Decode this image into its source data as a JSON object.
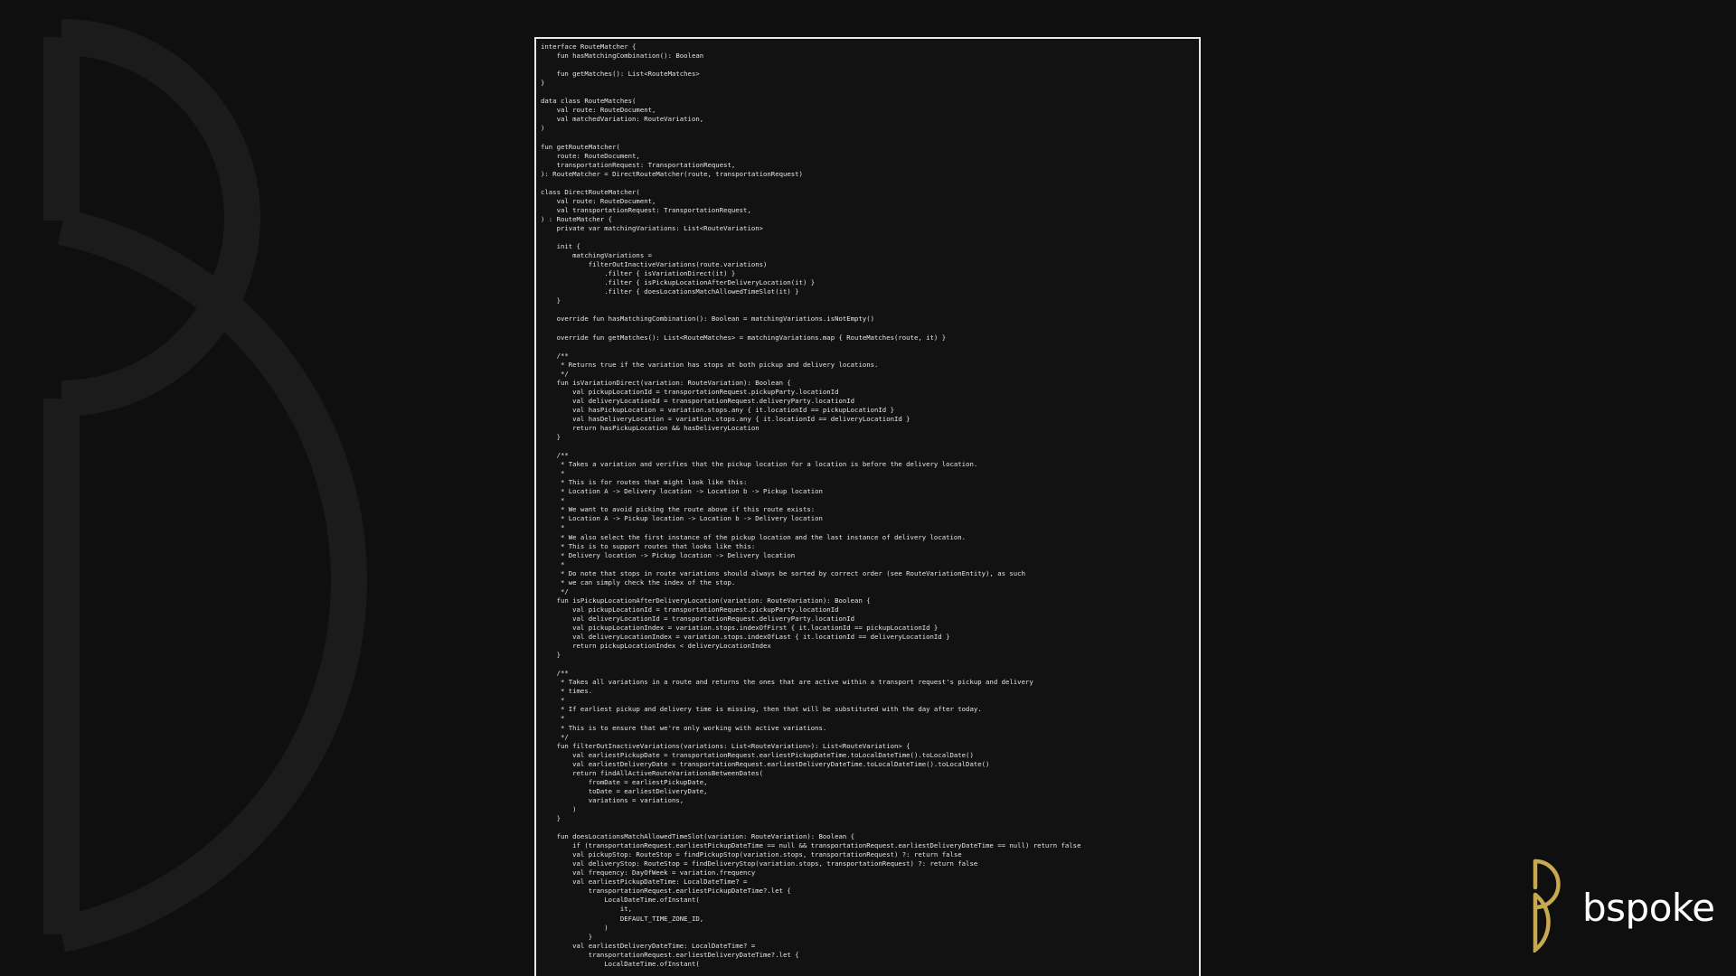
{
  "brand": {
    "name": "bspoke",
    "accent_color": "#c9a94f",
    "background_mark_color": "#1b1b1c"
  },
  "code": {
    "language": "kotlin",
    "lines": [
      "interface RouteMatcher {",
      "    fun hasMatchingCombination(): Boolean",
      "",
      "    fun getMatches(): List<RouteMatches>",
      "}",
      "",
      "data class RouteMatches(",
      "    val route: RouteDocument,",
      "    val matchedVariation: RouteVariation,",
      ")",
      "",
      "fun getRouteMatcher(",
      "    route: RouteDocument,",
      "    transportationRequest: TransportationRequest,",
      "): RouteMatcher = DirectRouteMatcher(route, transportationRequest)",
      "",
      "class DirectRouteMatcher(",
      "    val route: RouteDocument,",
      "    val transportationRequest: TransportationRequest,",
      ") : RouteMatcher {",
      "    private var matchingVariations: List<RouteVariation>",
      "",
      "    init {",
      "        matchingVariations =",
      "            filterOutInactiveVariations(route.variations)",
      "                .filter { isVariationDirect(it) }",
      "                .filter { isPickupLocationAfterDeliveryLocation(it) }",
      "                .filter { doesLocationsMatchAllowedTimeSlot(it) }",
      "    }",
      "",
      "    override fun hasMatchingCombination(): Boolean = matchingVariations.isNotEmpty()",
      "",
      "    override fun getMatches(): List<RouteMatches> = matchingVariations.map { RouteMatches(route, it) }",
      "",
      "    /**",
      "     * Returns true if the variation has stops at both pickup and delivery locations.",
      "     */",
      "    fun isVariationDirect(variation: RouteVariation): Boolean {",
      "        val pickupLocationId = transportationRequest.pickupParty.locationId",
      "        val deliveryLocationId = transportationRequest.deliveryParty.locationId",
      "        val hasPickupLocation = variation.stops.any { it.locationId == pickupLocationId }",
      "        val hasDeliveryLocation = variation.stops.any { it.locationId == deliveryLocationId }",
      "        return hasPickupLocation && hasDeliveryLocation",
      "    }",
      "",
      "    /**",
      "     * Takes a variation and verifies that the pickup location for a location is before the delivery location.",
      "     *",
      "     * This is for routes that might look like this:",
      "     * Location A -> Delivery location -> Location b -> Pickup location",
      "     *",
      "     * We want to avoid picking the route above if this route exists:",
      "     * Location A -> Pickup location -> Location b -> Delivery location",
      "     *",
      "     * We also select the first instance of the pickup location and the last instance of delivery location.",
      "     * This is to support routes that looks like this:",
      "     * Delivery location -> Pickup location -> Delivery location",
      "     *",
      "     * Do note that stops in route variations should always be sorted by correct order (see RouteVariationEntity), as such",
      "     * we can simply check the index of the stop.",
      "     */",
      "    fun isPickupLocationAfterDeliveryLocation(variation: RouteVariation): Boolean {",
      "        val pickupLocationId = transportationRequest.pickupParty.locationId",
      "        val deliveryLocationId = transportationRequest.deliveryParty.locationId",
      "        val pickupLocationIndex = variation.stops.indexOfFirst { it.locationId == pickupLocationId }",
      "        val deliveryLocationIndex = variation.stops.indexOfLast { it.locationId == deliveryLocationId }",
      "        return pickupLocationIndex < deliveryLocationIndex",
      "    }",
      "",
      "    /**",
      "     * Takes all variations in a route and returns the ones that are active within a transport request's pickup and delivery",
      "     * times.",
      "     *",
      "     * If earliest pickup and delivery time is missing, then that will be substituted with the day after today.",
      "     *",
      "     * This is to ensure that we're only working with active variations.",
      "     */",
      "    fun filterOutInactiveVariations(variations: List<RouteVariation>): List<RouteVariation> {",
      "        val earliestPickupDate = transportationRequest.earliestPickupDateTime.toLocalDateTime().toLocalDate()",
      "        val earliestDeliveryDate = transportationRequest.earliestDeliveryDateTime.toLocalDateTime().toLocalDate()",
      "        return findAllActiveRouteVariationsBetweenDates(",
      "            fromDate = earliestPickupDate,",
      "            toDate = earliestDeliveryDate,",
      "            variations = variations,",
      "        )",
      "    }",
      "",
      "    fun doesLocationsMatchAllowedTimeSlot(variation: RouteVariation): Boolean {",
      "        if (transportationRequest.earliestPickupDateTime == null && transportationRequest.earliestDeliveryDateTime == null) return false",
      "        val pickupStop: RouteStop = findPickupStop(variation.stops, transportationRequest) ?: return false",
      "        val deliveryStop: RouteStop = findDeliveryStop(variation.stops, transportationRequest) ?: return false",
      "        val frequency: DayOfWeek = variation.frequency",
      "        val earliestPickupDateTime: LocalDateTime? =",
      "            transportationRequest.earliestPickupDateTime?.let {",
      "                LocalDateTime.ofInstant(",
      "                    it,",
      "                    DEFAULT_TIME_ZONE_ID,",
      "                )",
      "            }",
      "        val earliestDeliveryDateTime: LocalDateTime? =",
      "            transportationRequest.earliestDeliveryDateTime?.let {",
      "                LocalDateTime.ofInstant("
    ]
  }
}
